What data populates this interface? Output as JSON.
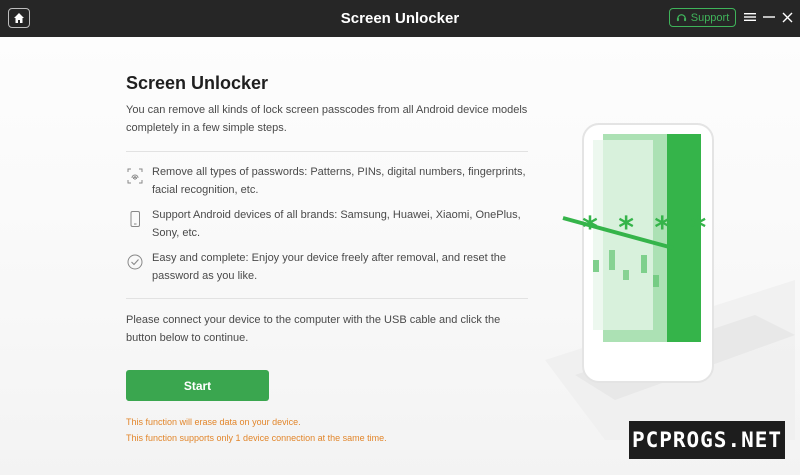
{
  "titlebar": {
    "title": "Screen Unlocker",
    "support_label": "Support"
  },
  "main": {
    "heading": "Screen Unlocker",
    "intro": "You can remove all kinds of lock screen passcodes from all Android device models completely in a few simple steps.",
    "features": [
      {
        "icon": "fingerprint-icon",
        "text": "Remove all types of passwords: Patterns, PINs, digital numbers, fingerprints, facial recognition, etc."
      },
      {
        "icon": "phone-icon",
        "text": "Support Android devices of all brands: Samsung, Huawei, Xiaomi, OnePlus, Sony, etc."
      },
      {
        "icon": "check-circle-icon",
        "text": "Easy and complete: Enjoy your device freely after removal, and reset the password as you like."
      }
    ],
    "connect_text": "Please connect your device to the computer with the USB cable and click the button below to continue.",
    "start_label": "Start",
    "warnings": [
      "This function will erase data on your device.",
      "This function supports only 1 device connection at the same time."
    ]
  },
  "illustration": {
    "password_mask": "* * * *"
  },
  "watermark": "PCPROGS.NET",
  "colors": {
    "titlebar": "#262626",
    "accent": "#3aa64f",
    "warning": "#e2862b"
  }
}
